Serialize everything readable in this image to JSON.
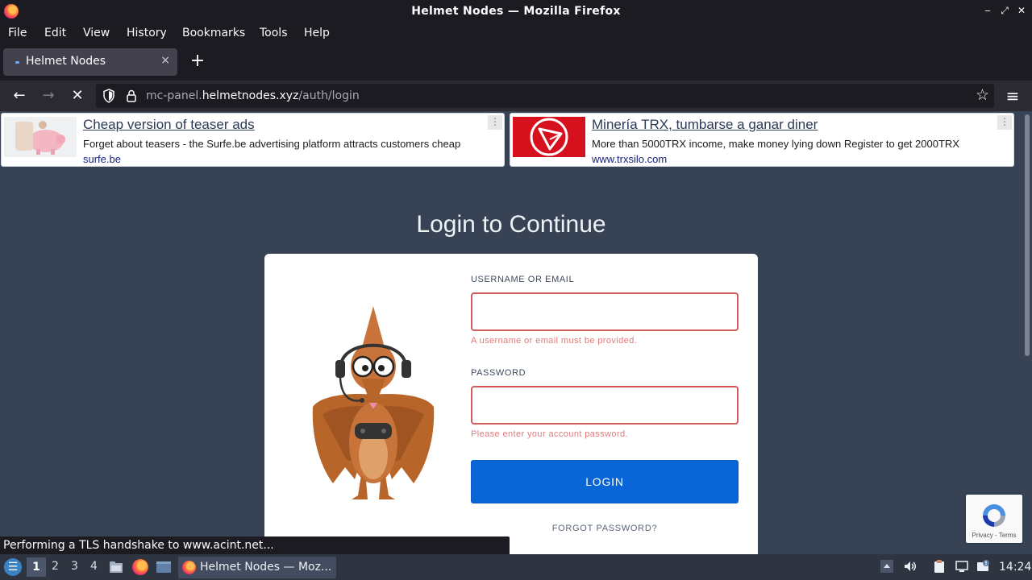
{
  "window": {
    "title": "Helmet Nodes — Mozilla Firefox",
    "minimize": "‒",
    "maximize": "⤢",
    "close": "✕"
  },
  "menu": {
    "file": "File",
    "edit": "Edit",
    "view": "View",
    "history": "History",
    "bookmarks": "Bookmarks",
    "tools": "Tools",
    "help": "Help"
  },
  "tab": {
    "label": "Helmet Nodes",
    "close": "×",
    "new_tab": "+"
  },
  "nav": {
    "back": "←",
    "forward": "→",
    "stop": "✕",
    "url_prefix": "mc-panel.",
    "url_host": "helmetnodes.xyz",
    "url_path": "/auth/login",
    "bookmark_star": "☆",
    "menu": "≡"
  },
  "ads": [
    {
      "title": "Cheap version of teaser ads",
      "description": "Forget about teasers - the Surfe.be advertising platform attracts customers cheap",
      "source": "surfe.be",
      "menu": "⋮"
    },
    {
      "title": "Minería TRX, tumbarse a ganar diner",
      "description": "More than 5000TRX income, make money lying down Register to get 2000TRX",
      "source": "www.trxsilo.com",
      "menu": "⋮"
    }
  ],
  "login": {
    "heading": "Login to Continue",
    "username_label": "USERNAME OR EMAIL",
    "username_value": "",
    "username_error": "A username or email must be provided.",
    "password_label": "PASSWORD",
    "password_value": "",
    "password_error": "Please enter your account password.",
    "login_button": "LOGIN",
    "forgot_link": "FORGOT PASSWORD?"
  },
  "recaptcha": {
    "links": "Privacy - Terms"
  },
  "status": {
    "text": "Performing a TLS handshake to www.acint.net..."
  },
  "taskbar": {
    "workspaces": [
      "1",
      "2",
      "3",
      "4"
    ],
    "active_workspace": "1",
    "task_label": "Helmet Nodes — Moz...",
    "clock": "14:24"
  },
  "colors": {
    "page_background": "#374354",
    "login_button": "#0a66d6",
    "error": "#d25b5b",
    "browser_chrome": "#1c1b22"
  }
}
